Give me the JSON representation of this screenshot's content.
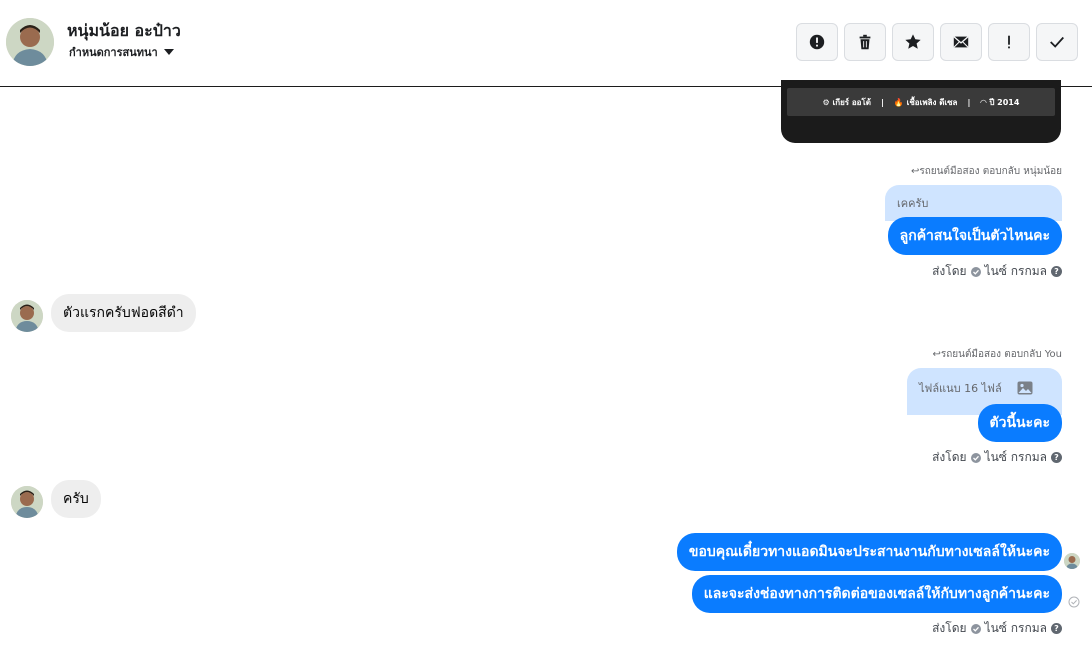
{
  "header": {
    "contact_name": "หนุ่มน้อย อะป๋าว",
    "manage_label": "กำหนดการสนทนา",
    "toolbar": [
      {
        "name": "spam-button",
        "icon": "alert-circle-icon"
      },
      {
        "name": "delete-button",
        "icon": "trash-icon"
      },
      {
        "name": "star-button",
        "icon": "star-icon"
      },
      {
        "name": "mark-unread-button",
        "icon": "envelope-icon"
      },
      {
        "name": "important-button",
        "icon": "exclamation-icon"
      },
      {
        "name": "done-button",
        "icon": "check-icon"
      }
    ]
  },
  "media_card": {
    "specs": [
      "⚙ เกียร์ ออโต้",
      "🔥 เชื้อเพลิง ดีเซล",
      "◠ ปี 2014"
    ]
  },
  "messages": {
    "reply1_hint": "↩รถยนต์มือสอง ตอบกลับ หนุ่มน้อย",
    "reply1_quote": "เคครับ",
    "reply1_text": "ลูกค้าสนใจเป็นตัวไหนคะ",
    "incoming1": "ตัวแรกครับฟอดสีดำ",
    "reply2_hint": "↩รถยนต์มือสอง ตอบกลับ You",
    "reply2_quote": "ไฟล์แนบ 16 ไฟล์",
    "reply2_text": "ตัวนี้นะคะ",
    "incoming2": "ครับ",
    "out3a": "ขอบคุณเดี๋ยวทางแอดมินจะประสานงานกับทางเซลล์ให้นะคะ",
    "out3b": "และจะส่งช่องทางการติดต่อของเซลล์ให้กับทางลูกค้านะคะ"
  },
  "sent_by": {
    "label": "ส่งโดย",
    "agent": "ไนซ์ กรกมล"
  },
  "colors": {
    "outgoing_bubble": "#0a7cff",
    "quoted_bubble": "#cfe4ff",
    "incoming_bubble": "#eeeeee"
  }
}
